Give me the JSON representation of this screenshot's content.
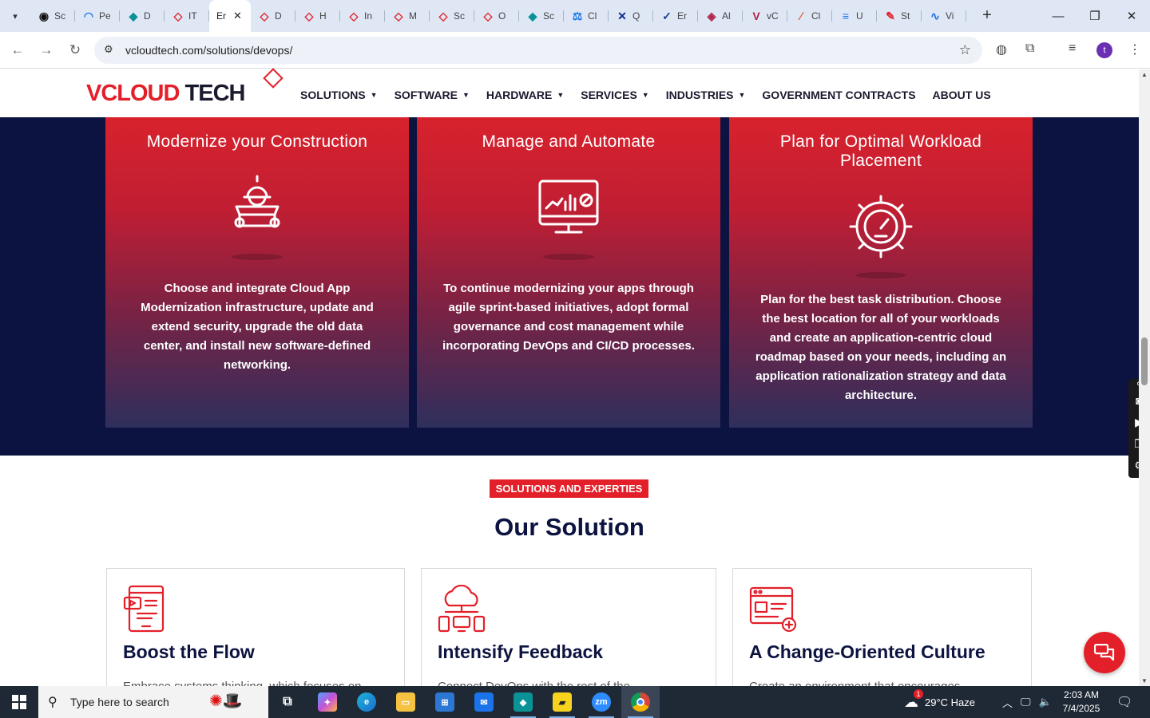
{
  "browser": {
    "tabs": [
      {
        "label": "Sc",
        "color": "#111111",
        "glyph": "◉"
      },
      {
        "label": "Pe",
        "color": "#1a73e8",
        "glyph": "◠"
      },
      {
        "label": "D",
        "color": "#0a9396",
        "glyph": "◆"
      },
      {
        "label": "IT",
        "color": "#e3202a",
        "glyph": "◇"
      },
      {
        "label": "Er",
        "color": "#ffffff",
        "glyph": "",
        "active": true
      },
      {
        "label": "D",
        "color": "#e3202a",
        "glyph": "◇"
      },
      {
        "label": "H",
        "color": "#e3202a",
        "glyph": "◇"
      },
      {
        "label": "In",
        "color": "#e3202a",
        "glyph": "◇"
      },
      {
        "label": "M",
        "color": "#e3202a",
        "glyph": "◇"
      },
      {
        "label": "Sc",
        "color": "#e3202a",
        "glyph": "◇"
      },
      {
        "label": "O",
        "color": "#e3202a",
        "glyph": "◇"
      },
      {
        "label": "Sc",
        "color": "#0a9396",
        "glyph": "◆"
      },
      {
        "label": "Cl",
        "color": "#1a73e8",
        "glyph": "⚖"
      },
      {
        "label": "Q",
        "color": "#0b2d8c",
        "glyph": "✕"
      },
      {
        "label": "Er",
        "color": "#1a3d8f",
        "glyph": "✓"
      },
      {
        "label": "Al",
        "color": "#b0224b",
        "glyph": "◈"
      },
      {
        "label": "vC",
        "color": "#b0224b",
        "glyph": "V"
      },
      {
        "label": "Cl",
        "color": "#e8552a",
        "glyph": "∕"
      },
      {
        "label": "U",
        "color": "#1a73e8",
        "glyph": "≡"
      },
      {
        "label": "St",
        "color": "#e3202a",
        "glyph": "✎"
      },
      {
        "label": "Vi",
        "color": "#1a73e8",
        "glyph": "∿"
      }
    ],
    "active_tab_close": "✕",
    "new_tab": "+",
    "window": {
      "minimize": "—",
      "restore": "❐",
      "close": "✕"
    },
    "url": "vcloudtech.com/solutions/devops/",
    "profile_initial": "t"
  },
  "site": {
    "logo_red": "VCLOUD",
    "logo_dark": "TECH",
    "nav": [
      {
        "label": "SOLUTIONS",
        "dropdown": true
      },
      {
        "label": "SOFTWARE",
        "dropdown": true
      },
      {
        "label": "HARDWARE",
        "dropdown": true
      },
      {
        "label": "SERVICES",
        "dropdown": true
      },
      {
        "label": "INDUSTRIES",
        "dropdown": true
      },
      {
        "label": "GOVERNMENT CONTRACTS",
        "dropdown": false
      },
      {
        "label": "ABOUT US",
        "dropdown": false
      }
    ]
  },
  "cards": [
    {
      "title": "Modernize your Construction",
      "icon": "construction-worker-icon",
      "text": "Choose and integrate Cloud App Modernization infrastructure, update and extend security, upgrade the old data center, and install new software-defined networking."
    },
    {
      "title": "Manage and Automate",
      "icon": "monitor-analytics-icon",
      "text": "To continue modernizing your apps through agile sprint-based initiatives, adopt formal governance and cost management while incorporating DevOps and CI/CD processes."
    },
    {
      "title": "Plan for Optimal Workload Placement",
      "icon": "gear-gauge-icon",
      "text": "Plan for the best task distribution. Choose the best location for all of your workloads and create an application-centric cloud roadmap based on your needs, including an application rationalization strategy and data architecture."
    }
  ],
  "solutions": {
    "tag": "SOLUTIONS AND EXPERTIES",
    "title": "Our Solution",
    "items": [
      {
        "title": "Boost the Flow",
        "icon": "tablet-video-icon",
        "text": "Embrace systems thinking, which focuses on"
      },
      {
        "title": "Intensify Feedback",
        "icon": "cloud-network-icon",
        "text": "Connect DevOps with the rest of the"
      },
      {
        "title": "A Change-Oriented Culture",
        "icon": "browser-add-icon",
        "text": "Create an environment that encourages"
      }
    ]
  },
  "taskbar": {
    "search_placeholder": "Type here to search",
    "weather": "29°C  Haze",
    "weather_badge": "1",
    "time": "2:03 AM",
    "date": "7/4/2025"
  },
  "colors": {
    "brand_red": "#e3202a",
    "navy": "#0c1340"
  }
}
